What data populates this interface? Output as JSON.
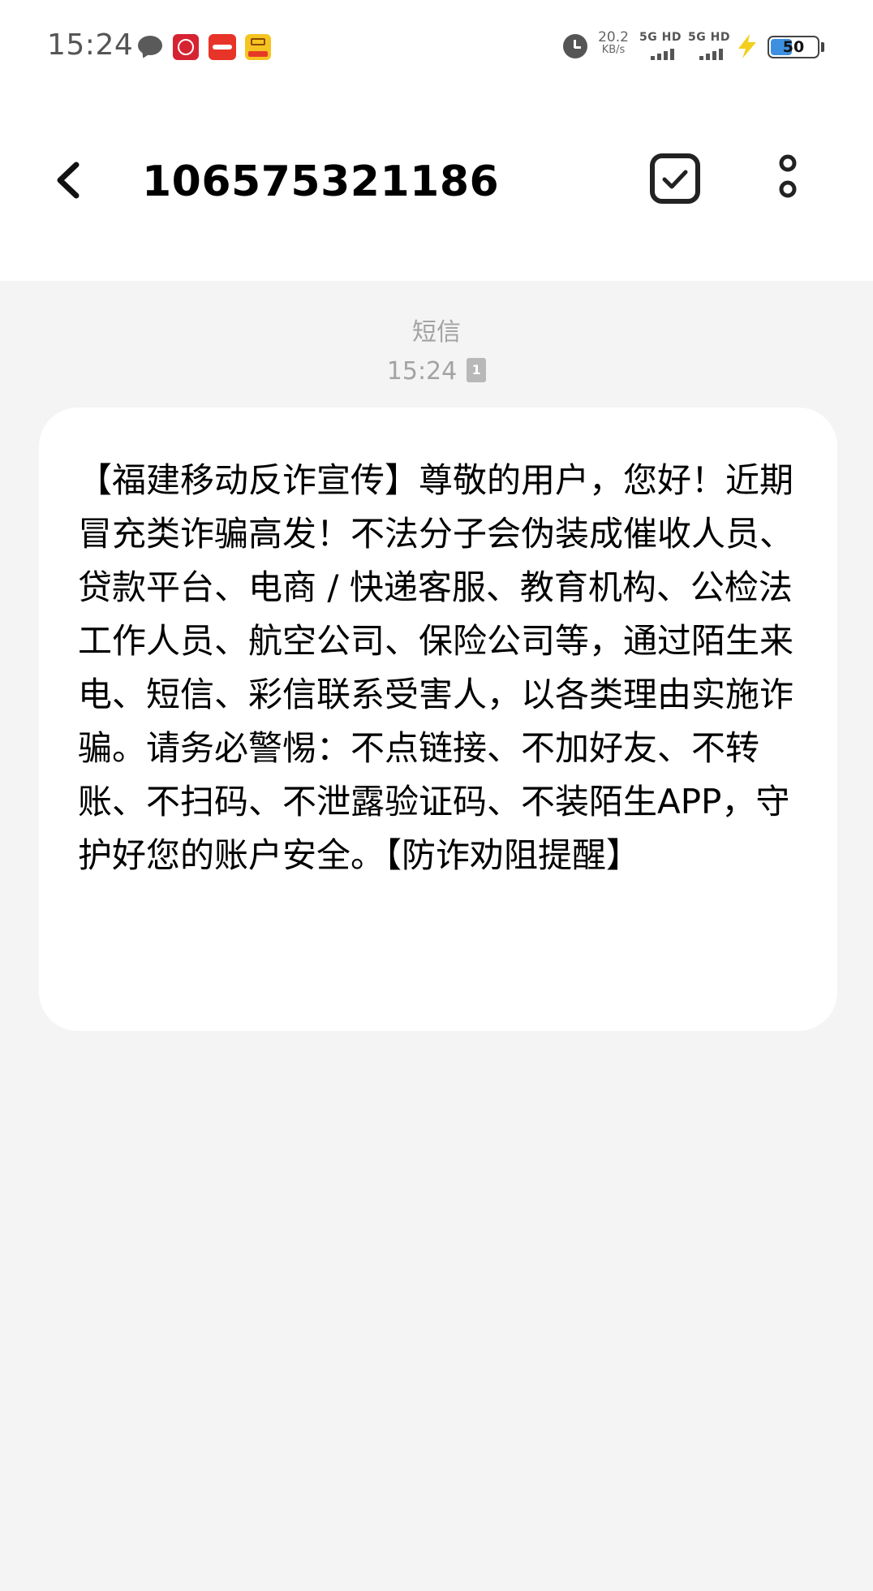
{
  "status_bar": {
    "time": "15:24",
    "net_speed_value": "20.2",
    "net_speed_unit": "KB/s",
    "sim1_label": "5G HD",
    "sim2_label": "5G HD",
    "battery_level": "50",
    "battery_percent": 50,
    "notification_icons": [
      "chat-bubble-icon",
      "citic-bank-app-icon",
      "haofenqi-app-icon",
      "xianyu-app-icon"
    ],
    "battery_color": "#3d8fe0"
  },
  "header": {
    "back_icon": "chevron-left-icon",
    "title": "106575321186",
    "select_icon": "checkbox-icon",
    "more_icon": "more-vertical-icon"
  },
  "conversation": {
    "message_type": "短信",
    "message_time": "15:24",
    "sim_indicator": "1",
    "messages": [
      {
        "text": "【福建移动反诈宣传】尊敬的用户，您好！近期冒充类诈骗高发！不法分子会伪装成催收人员、贷款平台、电商 / 快递客服、教育机构、公检法工作人员、航空公司、保险公司等，通过陌生来电、短信、彩信联系受害人，以各类理由实施诈骗。请务必警惕：不点链接、不加好友、不转账、不扫码、不泄露验证码、不装陌生APP，守护好您的账户安全。【防诈劝阻提醒】"
      }
    ]
  },
  "colors": {
    "background": "#f4f4f4",
    "bubble": "#ffffff",
    "meta_text": "#a3a3a3"
  }
}
